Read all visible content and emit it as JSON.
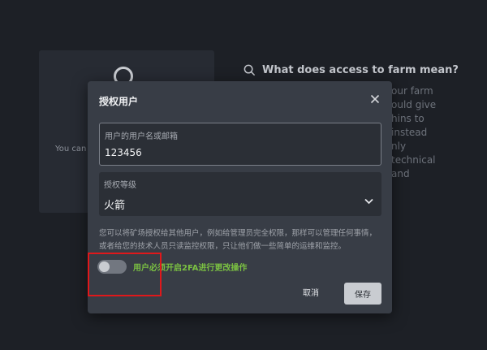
{
  "background": {
    "card_text": "You can",
    "help_title": "What does access to farm mean?",
    "help_lines": [
      "our farm",
      "ould give",
      "hins to",
      "instead",
      "nly",
      "technical",
      "and"
    ]
  },
  "modal": {
    "title": "授权用户",
    "username_field": {
      "label": "用户的用户名或邮箱",
      "value": "123456"
    },
    "level_field": {
      "label": "授权等级",
      "value": "火箭"
    },
    "description": "您可以将矿场授权给其他用户，例如给管理员完全权限，那样可以管理任何事情，或者给您的技术人员只读监控权限，只让他们做一些简单的运维和监控。",
    "toggle_label": "用户必须开启2FA进行更改操作",
    "toggle_on": false,
    "cancel_label": "取消",
    "save_label": "保存"
  },
  "colors": {
    "toggle_label": "#7bc142",
    "highlight": "#e0181b"
  }
}
